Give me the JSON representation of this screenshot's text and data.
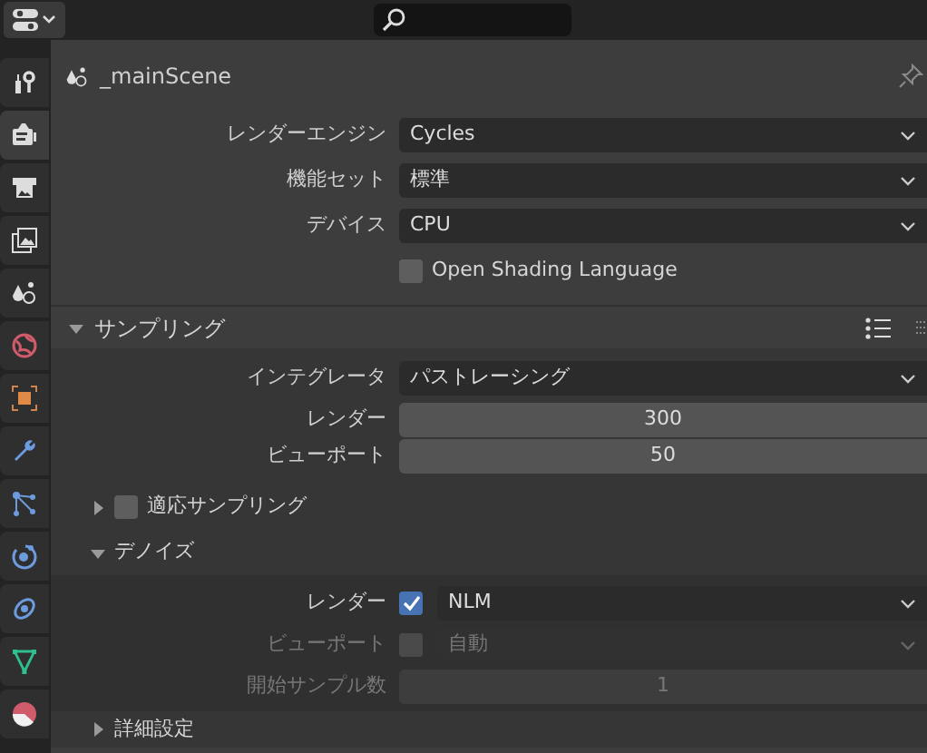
{
  "tabs": [
    {
      "kind": "tool",
      "selected": false
    },
    {
      "kind": "render",
      "selected": true
    },
    {
      "kind": "output",
      "selected": false
    },
    {
      "kind": "view_layer",
      "selected": false
    },
    {
      "kind": "scene",
      "selected": false
    },
    {
      "kind": "world",
      "selected": false
    },
    {
      "kind": "object",
      "selected": false
    },
    {
      "kind": "modifier",
      "selected": false
    },
    {
      "kind": "particles",
      "selected": false
    },
    {
      "kind": "physics",
      "selected": false
    },
    {
      "kind": "constraints",
      "selected": false
    },
    {
      "kind": "data",
      "selected": false
    },
    {
      "kind": "material",
      "selected": false
    }
  ],
  "scene": {
    "name": "_mainScene",
    "pinned": false
  },
  "settings": [
    {
      "kind": "dropdown",
      "label": "レンダーエンジン",
      "value": "Cycles",
      "disabled": false
    },
    {
      "kind": "dropdown",
      "label": "機能セット",
      "value": "標準",
      "disabled": false
    },
    {
      "kind": "dropdown",
      "label": "デバイス",
      "value": "CPU",
      "disabled": false
    },
    {
      "kind": "checkbox",
      "label": "Open Shading Language",
      "checked": false,
      "disabled": false
    }
  ],
  "panels": [
    {
      "title": "サンプリング",
      "expanded": true,
      "rows": [
        {
          "kind": "dropdown",
          "label": "インテグレータ",
          "value": "パストレーシング",
          "disabled": false
        },
        {
          "kind": "number",
          "label": "レンダー",
          "value": "300",
          "disabled": false
        },
        {
          "kind": "number",
          "label": "ビューポート",
          "value": "50",
          "disabled": false
        }
      ],
      "subpanels": [
        {
          "title": "適応サンプリング",
          "expanded": false,
          "kind": "toggle",
          "checked": false
        },
        {
          "title": "デノイズ",
          "expanded": true,
          "kind": "plain",
          "rows": [
            {
              "kind": "check_dropdown",
              "label": "レンダー",
              "checked": true,
              "value": "NLM",
              "disabled": false
            },
            {
              "kind": "check_dropdown",
              "label": "ビューポート",
              "checked": false,
              "value": "自動",
              "disabled": true
            },
            {
              "kind": "number",
              "label": "開始サンプル数",
              "value": "1",
              "disabled": true
            }
          ]
        },
        {
          "title": "詳細設定",
          "expanded": false,
          "kind": "plain"
        }
      ]
    }
  ]
}
